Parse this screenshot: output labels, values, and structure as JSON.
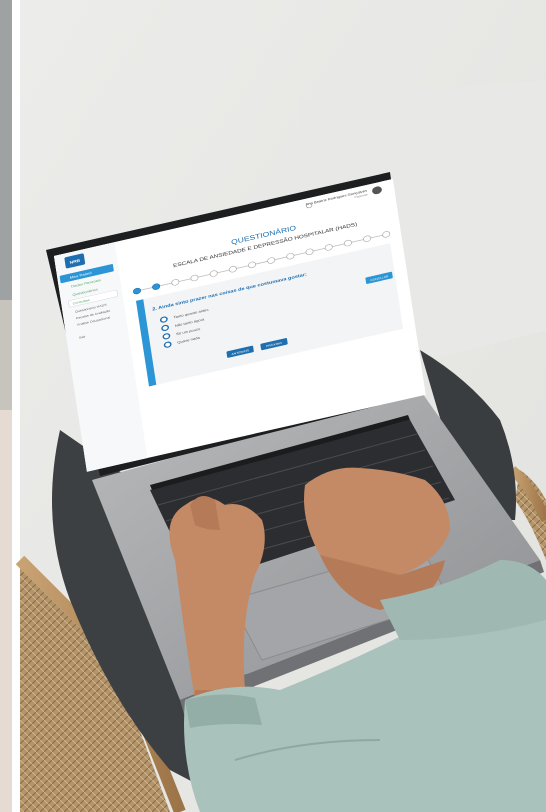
{
  "app": {
    "logo_text": "NRB",
    "user_name": "Ana Beatriz Rodrigues Gonçalves",
    "user_role": "Paciente"
  },
  "sidebar": {
    "items": [
      {
        "label": "Meu Painel",
        "active": true
      },
      {
        "label": "Dados Pessoais"
      },
      {
        "label": "Questionários"
      },
      {
        "label": "Consultas"
      },
      {
        "label": "Questionário HADS"
      },
      {
        "label": "Escalas de Avaliação"
      },
      {
        "label": "Análise Ocupacional"
      },
      {
        "label": "Sair"
      }
    ]
  },
  "questionnaire": {
    "title": "QUESTIONÁRIO",
    "subtitle": "ESCALA DE ANSIEDADE E DEPRESSÃO HOSPITALAR (HADS)",
    "steps_total": 14,
    "current_step": 2,
    "question": "2. Ainda sinto prazer nas coisas de que costumava gostar:",
    "options": [
      "Tanto quanto antes",
      "Não tanto agora",
      "Só um pouco",
      "Quase nada"
    ],
    "btn_back": "ANTERIOR",
    "btn_next": "PRÓXIMO",
    "btn_side": "CONCLUIR"
  },
  "colors": {
    "accent": "#2b95d6",
    "accent_dark": "#1f6fb0",
    "laptop_body": "#9a9c9f",
    "sweater": "#a9c2bb",
    "skin": "#c48a66",
    "pants": "#3a3d40",
    "chair": "#b99466"
  }
}
